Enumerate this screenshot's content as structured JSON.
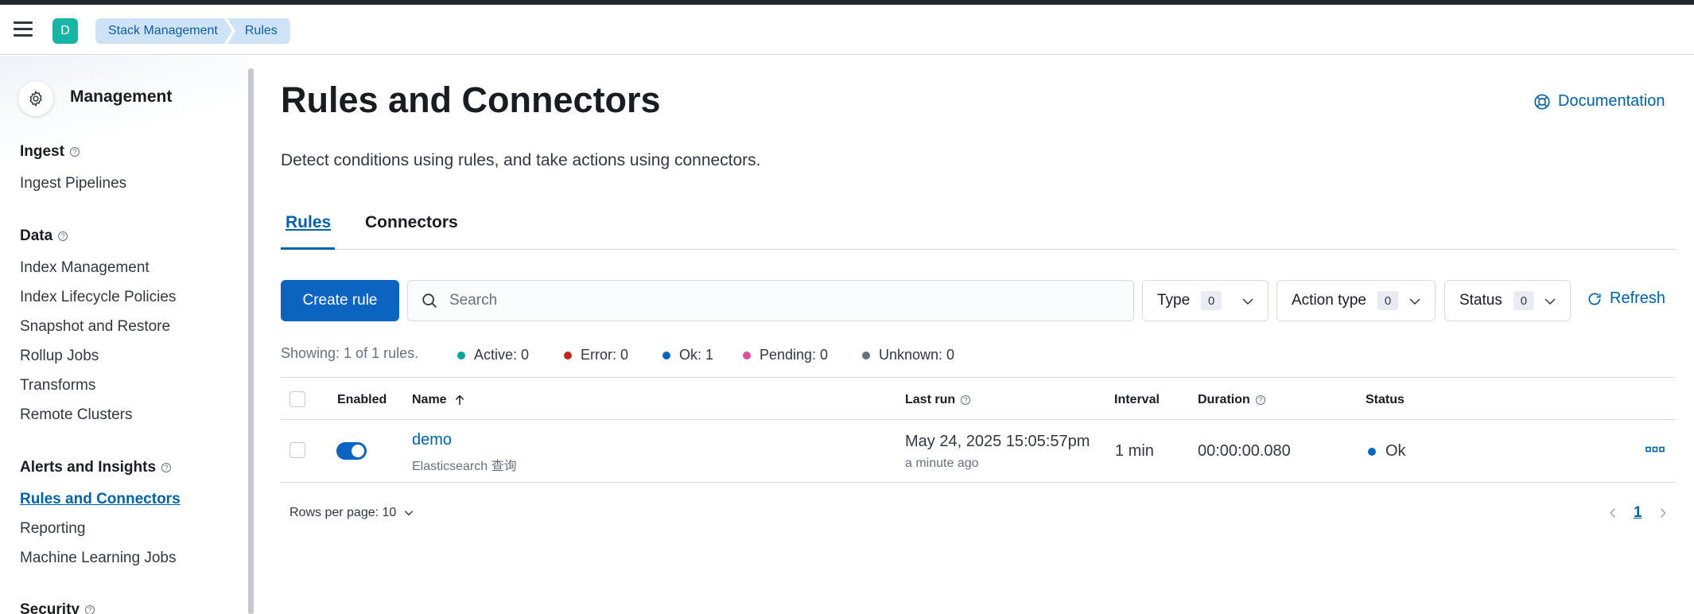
{
  "header": {
    "space_initial": "D",
    "breadcrumbs": [
      "Stack Management",
      "Rules"
    ]
  },
  "sidebar": {
    "title": "Management",
    "sections": [
      {
        "label": "Ingest",
        "items": [
          "Ingest Pipelines"
        ]
      },
      {
        "label": "Data",
        "items": [
          "Index Management",
          "Index Lifecycle Policies",
          "Snapshot and Restore",
          "Rollup Jobs",
          "Transforms",
          "Remote Clusters"
        ]
      },
      {
        "label": "Alerts and Insights",
        "items": [
          "Rules and Connectors",
          "Reporting",
          "Machine Learning Jobs"
        ]
      },
      {
        "label": "Security",
        "items": []
      }
    ],
    "active_item": "Rules and Connectors"
  },
  "main": {
    "title": "Rules and Connectors",
    "subtitle": "Detect conditions using rules, and take actions using connectors.",
    "documentation": "Documentation",
    "tabs": [
      "Rules",
      "Connectors"
    ],
    "active_tab": "Rules",
    "create_rule": "Create rule",
    "search_placeholder": "Search",
    "filters": [
      {
        "label": "Type",
        "count": "0"
      },
      {
        "label": "Action type",
        "count": "0"
      },
      {
        "label": "Status",
        "count": "0"
      }
    ],
    "refresh": "Refresh",
    "showing": "Showing: 1 of 1 rules.",
    "stats": [
      {
        "label": "Active: 0",
        "color": "#00a69b"
      },
      {
        "label": "Error: 0",
        "color": "#bd271e"
      },
      {
        "label": "Ok: 1",
        "color": "#0b64c0"
      },
      {
        "label": "Pending: 0",
        "color": "#e24c9b"
      },
      {
        "label": "Unknown: 0",
        "color": "#69707d"
      }
    ],
    "table": {
      "columns": [
        "Enabled",
        "Name",
        "Last run",
        "Interval",
        "Duration",
        "Status"
      ],
      "rows": [
        {
          "enabled": true,
          "name": "demo",
          "type": "Elasticsearch 查询",
          "last_run": "May 24, 2025 15:05:57pm",
          "last_run_ago": "a minute ago",
          "interval": "1 min",
          "duration": "00:00:00.080",
          "status": "Ok"
        }
      ]
    },
    "rows_per_page": "Rows per page: 10",
    "page": "1"
  },
  "colors": {
    "primary": "#0b64c0",
    "link": "#0061a6",
    "space_avatar": "#17b5a6"
  }
}
